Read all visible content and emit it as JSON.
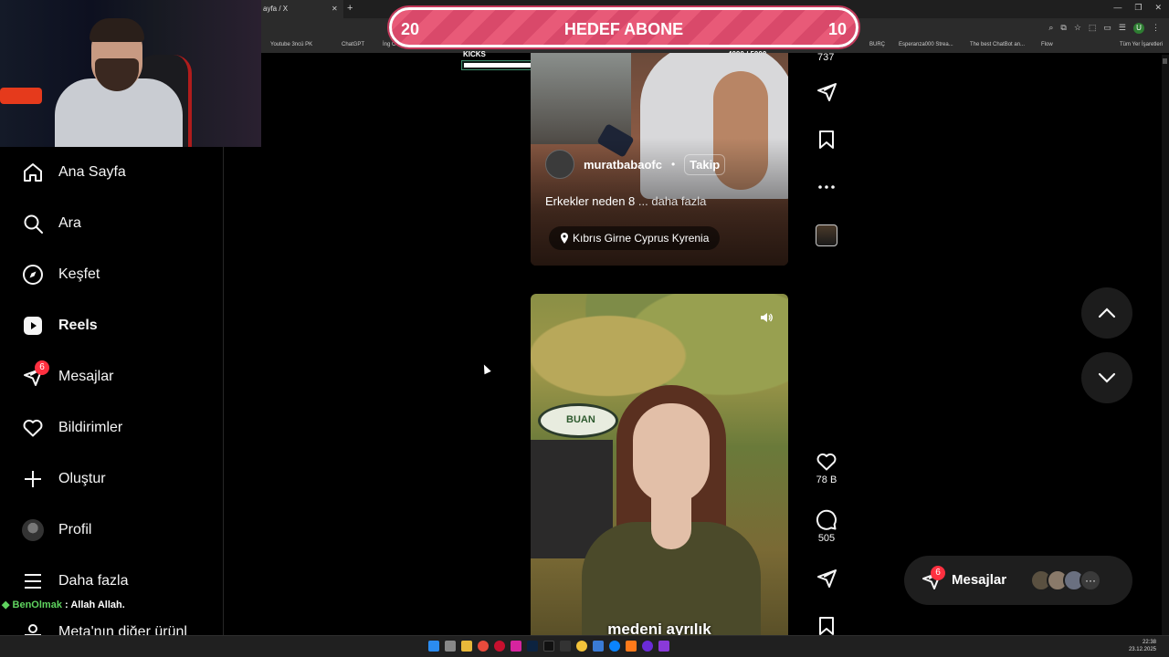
{
  "browser": {
    "tab_title": "ayfa / X",
    "bookmarks": [
      "Youtube 3ncü PK",
      "ChatGPT",
      "İng C",
      "BURÇ",
      "Esperanza000 Strea...",
      "The best ChatBot an...",
      "Flow",
      "Tüm Yer İşaretleri"
    ],
    "profile_initial": "U"
  },
  "goal": {
    "title": "HEDEF ABONE",
    "left_number": "20",
    "right_number": "10"
  },
  "kicks": {
    "label": "KICKS",
    "count": "4000 / 5000",
    "progress": 0.8
  },
  "sidebar": {
    "items": [
      {
        "label": "Ana Sayfa",
        "icon": "home-icon"
      },
      {
        "label": "Ara",
        "icon": "search-icon"
      },
      {
        "label": "Keşfet",
        "icon": "compass-icon"
      },
      {
        "label": "Reels",
        "icon": "reels-icon"
      },
      {
        "label": "Mesajlar",
        "icon": "messenger-icon",
        "badge": "6"
      },
      {
        "label": "Bildirimler",
        "icon": "heart-icon"
      },
      {
        "label": "Oluştur",
        "icon": "plus-icon"
      },
      {
        "label": "Profil",
        "icon": "avatar"
      },
      {
        "label": "Daha fazla",
        "icon": "menu-icon"
      },
      {
        "label": "Meta'nın diğer ürünl",
        "icon": "meta-icon"
      }
    ]
  },
  "chat_overlay": {
    "user": "BenOlmak",
    "message": " : Allah Allah."
  },
  "reel1": {
    "top_count": "737",
    "username": "muratbabaofc",
    "separator": "•",
    "follow_label": "Takip",
    "caption": "Erkekler neden 8",
    "more_label": "... daha fazla",
    "location": "Kıbrıs Girne Cyprus Kyrenia"
  },
  "reel2": {
    "sign_text": "BUAN",
    "subtitle": "medeni ayrılık",
    "like_count": "78 B",
    "comment_count": "505"
  },
  "messages_widget": {
    "label": "Mesajlar",
    "badge": "6",
    "more": "···"
  },
  "taskbar": {
    "time": "22:38",
    "date": "23.12.2025"
  }
}
